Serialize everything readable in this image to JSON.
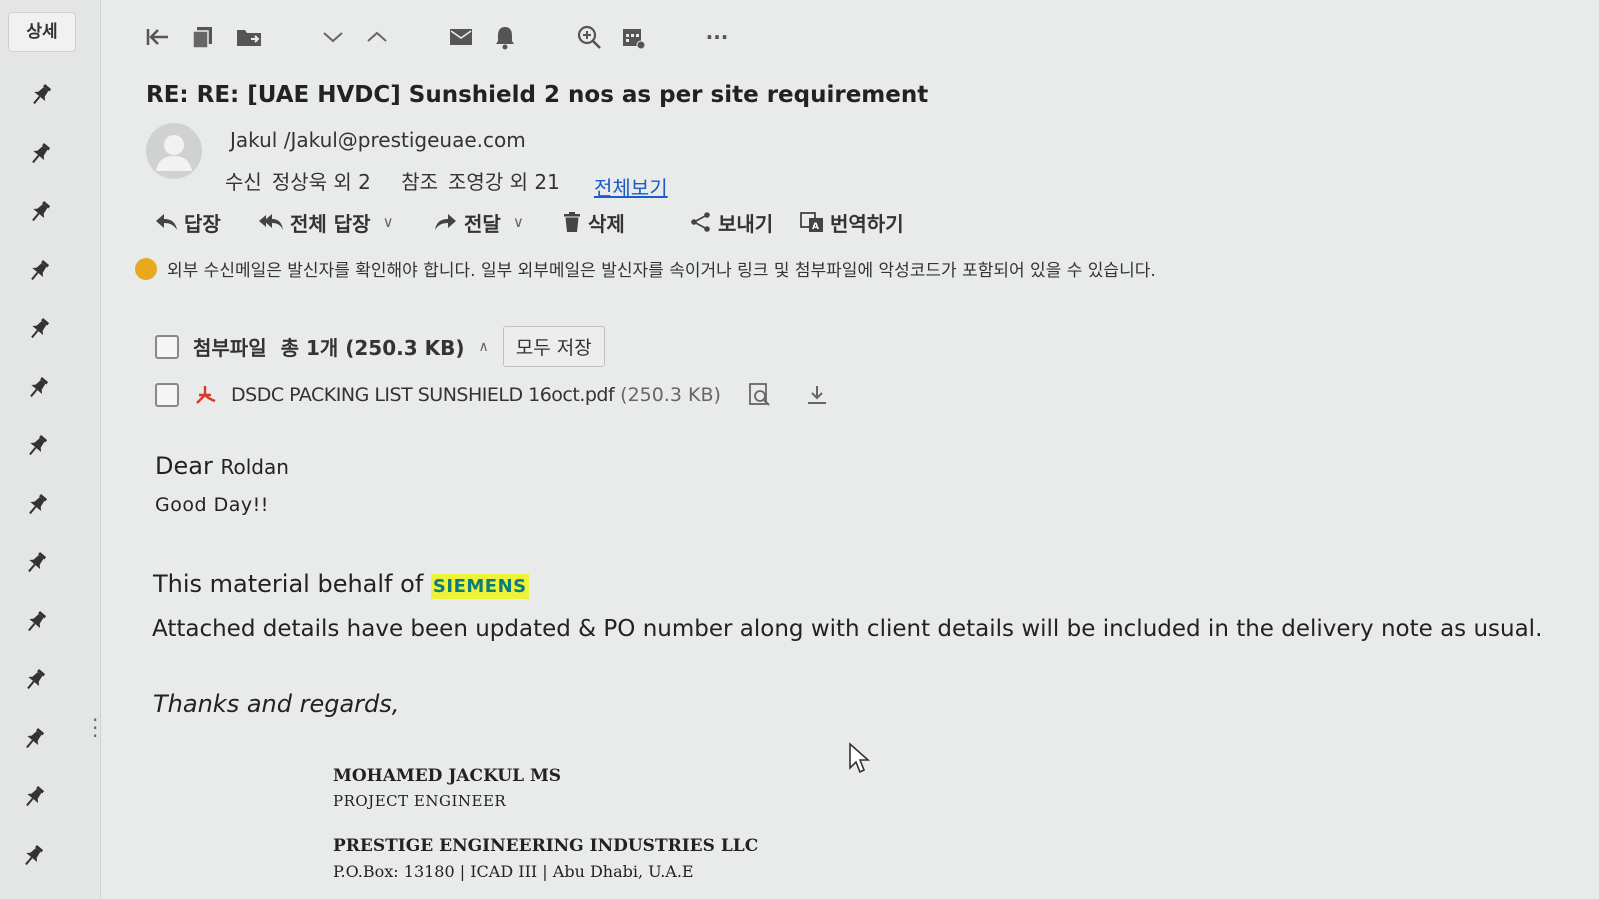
{
  "sidebar": {
    "tab_label": "상세",
    "pin_count": 14
  },
  "toolbar": {
    "icons": [
      "first-icon",
      "copy-icon",
      "move-folder-icon",
      "chevron-down-icon",
      "chevron-up-icon",
      "mail-icon",
      "bell-icon",
      "zoom-icon",
      "calendar-icon",
      "more-icon"
    ],
    "more_label": "···"
  },
  "email": {
    "subject": "RE: RE: [UAE HVDC] Sunshield 2 nos as per site requirement",
    "sender": "Jakul  /Jakul@prestigeuae.com",
    "to_label": "수신",
    "to_value": "정상욱 외 2",
    "cc_label": "참조",
    "cc_value": "조영강 외 21",
    "view_all": "전체보기"
  },
  "actions": {
    "reply": "답장",
    "reply_all": "전체 답장",
    "forward": "전달",
    "delete": "삭제",
    "send": "보내기",
    "translate": "번역하기"
  },
  "warning": "외부 수신메일은 발신자를 확인해야 합니다. 일부 외부메일은 발신자를 속이거나 링크 및 첨부파일에 악성코드가 포함되어 있을 수 있습니다.",
  "attachments": {
    "label": "첨부파일",
    "summary": "총 1개  (250.3 KB)",
    "save_all": "모두 저장",
    "files": [
      {
        "name": "DSDC PACKING LIST SUNSHIELD 16oct.pdf",
        "size": "(250.3 KB)"
      }
    ]
  },
  "body": {
    "dear": "Dear",
    "dear_name": "Roldan",
    "good_day": "Good Day!!",
    "material_prefix": "This material behalf of",
    "company_highlight": "SIEMENS",
    "attached_line": "Attached  details have been updated & PO number along with client details will be included in the delivery note as usual.",
    "thanks": "Thanks and regards,"
  },
  "signature": {
    "name": "MOHAMED JACKUL MS",
    "title": "PROJECT  ENGINEER",
    "company": "PRESTIGE ENGINEERING INDUSTRIES LLC",
    "address": "P.O.Box: 13180 | ICAD III | Abu Dhabi, U.A.E"
  },
  "colors": {
    "link": "#1a5cc8",
    "highlight": "#eef33a",
    "warning": "#e9a91c"
  }
}
